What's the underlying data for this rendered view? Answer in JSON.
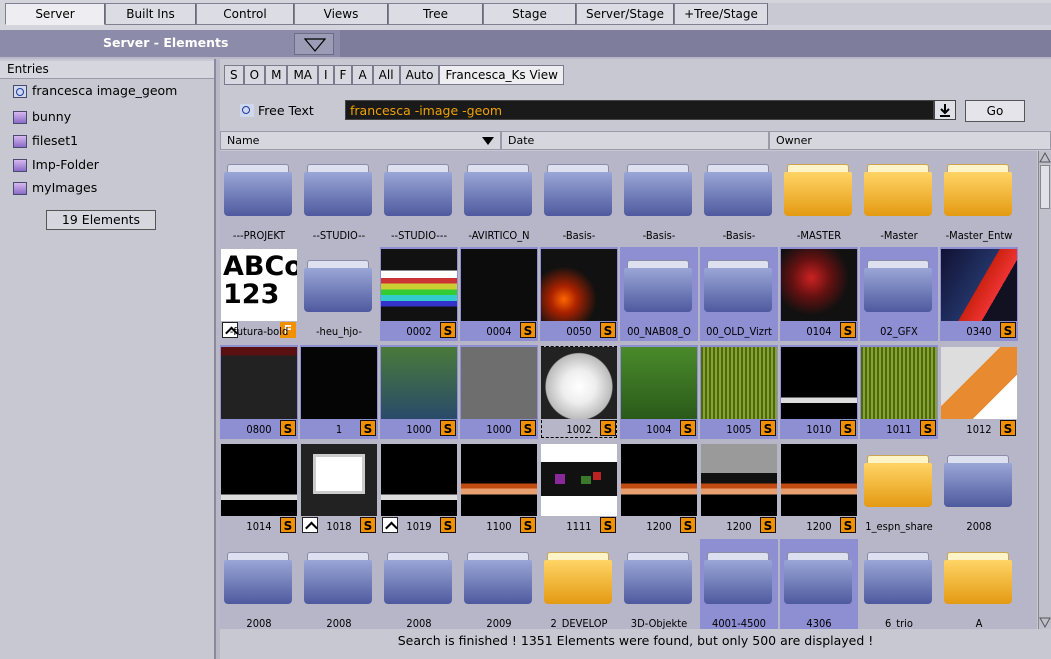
{
  "top_tabs": [
    {
      "label": "Server",
      "active": true
    },
    {
      "label": "Built Ins"
    },
    {
      "label": "Control"
    },
    {
      "label": "Views"
    },
    {
      "label": "Tree"
    },
    {
      "label": "Stage"
    },
    {
      "label": "Server/Stage"
    },
    {
      "label": "+Tree/Stage"
    }
  ],
  "header": {
    "title": "Server - Elements"
  },
  "left_panel": {
    "heading": "Entries",
    "entries": [
      {
        "label": "francesca image_geom",
        "icon": "search-icon"
      },
      {
        "label": "bunny",
        "icon": "folder-icon"
      },
      {
        "label": "fileset1",
        "icon": "folder-icon"
      },
      {
        "label": "Imp-Folder",
        "icon": "folder-icon"
      },
      {
        "label": "myImages",
        "icon": "folder-icon"
      }
    ],
    "count": "19 Elements"
  },
  "filters": [
    "S",
    "O",
    "M",
    "MA",
    "I",
    "F",
    "A",
    "All",
    "Auto",
    "Francesca_Ks View"
  ],
  "search": {
    "mode_label": "Free Text",
    "value": "francesca -image -geom",
    "go_label": "Go"
  },
  "columns": [
    "Name",
    "Date",
    "Owner"
  ],
  "grid_rows": [
    [
      {
        "label": "---PROJEKT",
        "kind": "folder-blue"
      },
      {
        "label": "--STUDIO--",
        "kind": "folder-blue"
      },
      {
        "label": "--STUDIO---",
        "kind": "folder-blue"
      },
      {
        "label": "-AVIRTICO_N",
        "kind": "folder-blue"
      },
      {
        "label": "-Basis-",
        "kind": "folder-blue"
      },
      {
        "label": "-Basis-",
        "kind": "folder-blue"
      },
      {
        "label": "-Basis-",
        "kind": "folder-blue"
      },
      {
        "label": "-MASTER",
        "kind": "folder-yellow"
      },
      {
        "label": "-Master",
        "kind": "folder-yellow"
      },
      {
        "label": "-Master_Entw",
        "kind": "folder-yellow"
      }
    ],
    [
      {
        "label": "-futura-bold",
        "kind": "image-abc"
      },
      {
        "label": "-heu_hjo-",
        "kind": "folder-blue"
      },
      {
        "label": "0002",
        "kind": "image-testcard"
      },
      {
        "label": "0004",
        "kind": "image-darktext"
      },
      {
        "label": "0050",
        "kind": "image-fire"
      },
      {
        "label": "00_NAB08_O",
        "kind": "folder-blue"
      },
      {
        "label": "00_OLD_Vizrt",
        "kind": "folder-blue"
      },
      {
        "label": "0104",
        "kind": "image-red"
      },
      {
        "label": "02_GFX",
        "kind": "folder-blue"
      },
      {
        "label": "0340",
        "kind": "image-weather"
      }
    ],
    [
      {
        "label": "0800",
        "kind": "image-table"
      },
      {
        "label": "1",
        "kind": "image-black"
      },
      {
        "label": "1000",
        "kind": "image-screen"
      },
      {
        "label": "1000",
        "kind": "image-grey"
      },
      {
        "label": "1002",
        "kind": "image-white"
      },
      {
        "label": "1004",
        "kind": "image-grass"
      },
      {
        "label": "1005",
        "kind": "image-stripes"
      },
      {
        "label": "1010",
        "kind": "image-lowerbar"
      },
      {
        "label": "1011",
        "kind": "image-stripes"
      },
      {
        "label": "1012",
        "kind": "image-orange"
      }
    ],
    [
      {
        "label": "1014",
        "kind": "image-lowerbar"
      },
      {
        "label": "1018",
        "kind": "image-frame"
      },
      {
        "label": "1019",
        "kind": "image-lowerbar"
      },
      {
        "label": "1100",
        "kind": "image-orangebar"
      },
      {
        "label": "1111",
        "kind": "image-squares"
      },
      {
        "label": "1200",
        "kind": "image-orangebar"
      },
      {
        "label": "1200",
        "kind": "image-greybar"
      },
      {
        "label": "1200",
        "kind": "image-orangebar"
      },
      {
        "label": "1_espn_share",
        "kind": "folder-yellow"
      },
      {
        "label": "2008",
        "kind": "folder-blue"
      }
    ],
    [
      {
        "label": "2008",
        "kind": "folder-blue"
      },
      {
        "label": "2008",
        "kind": "folder-blue"
      },
      {
        "label": "2008",
        "kind": "folder-blue"
      },
      {
        "label": "2009",
        "kind": "folder-blue"
      },
      {
        "label": "2_DEVELOP",
        "kind": "folder-yellow"
      },
      {
        "label": "3D-Objekte",
        "kind": "folder-blue"
      },
      {
        "label": "4001-4500",
        "kind": "folder-blue"
      },
      {
        "label": "4306",
        "kind": "folder-blue"
      },
      {
        "label": "6_trio",
        "kind": "folder-blue"
      },
      {
        "label": "A",
        "kind": "folder-yellow"
      }
    ]
  ],
  "status_text": "Search is finished ! 1351 Elements were found, but only 500 are displayed !"
}
